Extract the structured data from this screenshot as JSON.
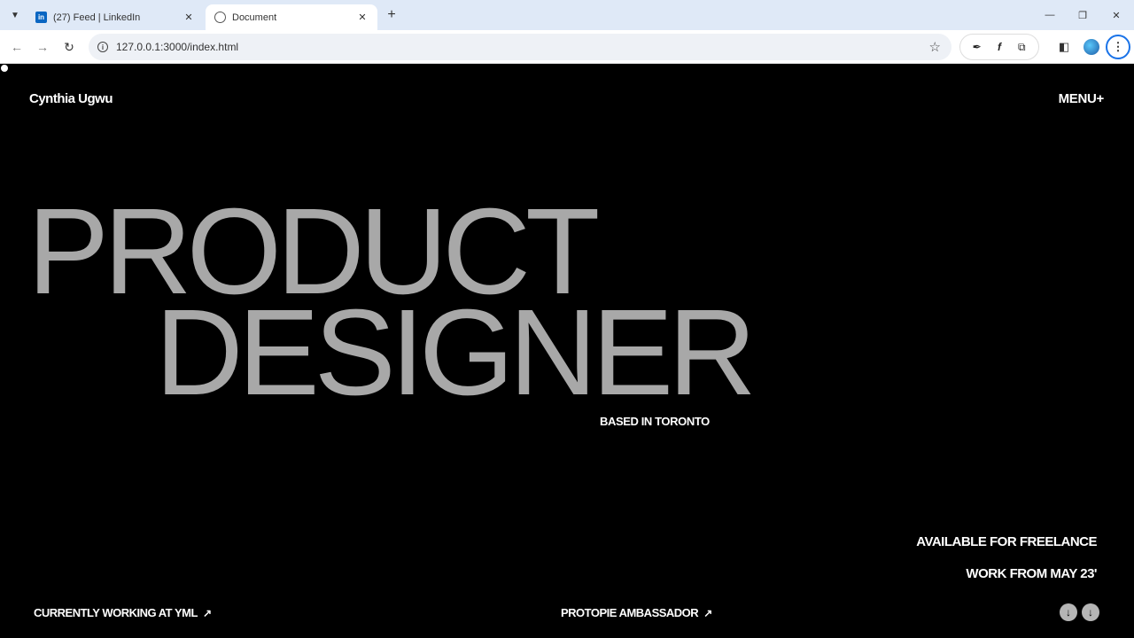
{
  "browser": {
    "tabs": [
      {
        "title": "(27) Feed | LinkedIn",
        "favicon": "linkedin-icon"
      },
      {
        "title": "Document",
        "favicon": "globe-icon"
      }
    ],
    "url": "127.0.0.1:3000/index.html"
  },
  "page": {
    "brand": "Cynthia Ugwu",
    "menu": "MENU+",
    "hero_line1": "PRODUCT",
    "hero_line2": "DESIGNER",
    "location": "BASED IN TORONTO",
    "availability": "AVAILABLE FOR FREELANCE",
    "work_from": "WORK FROM MAY 23'",
    "link_current": "CURRENTLY WORKING AT YML",
    "link_protopie": "PROTOPIE AMBASSADOR",
    "colors": {
      "background": "#000000",
      "hero_text": "#a8a8a8",
      "text": "#ffffff"
    }
  }
}
